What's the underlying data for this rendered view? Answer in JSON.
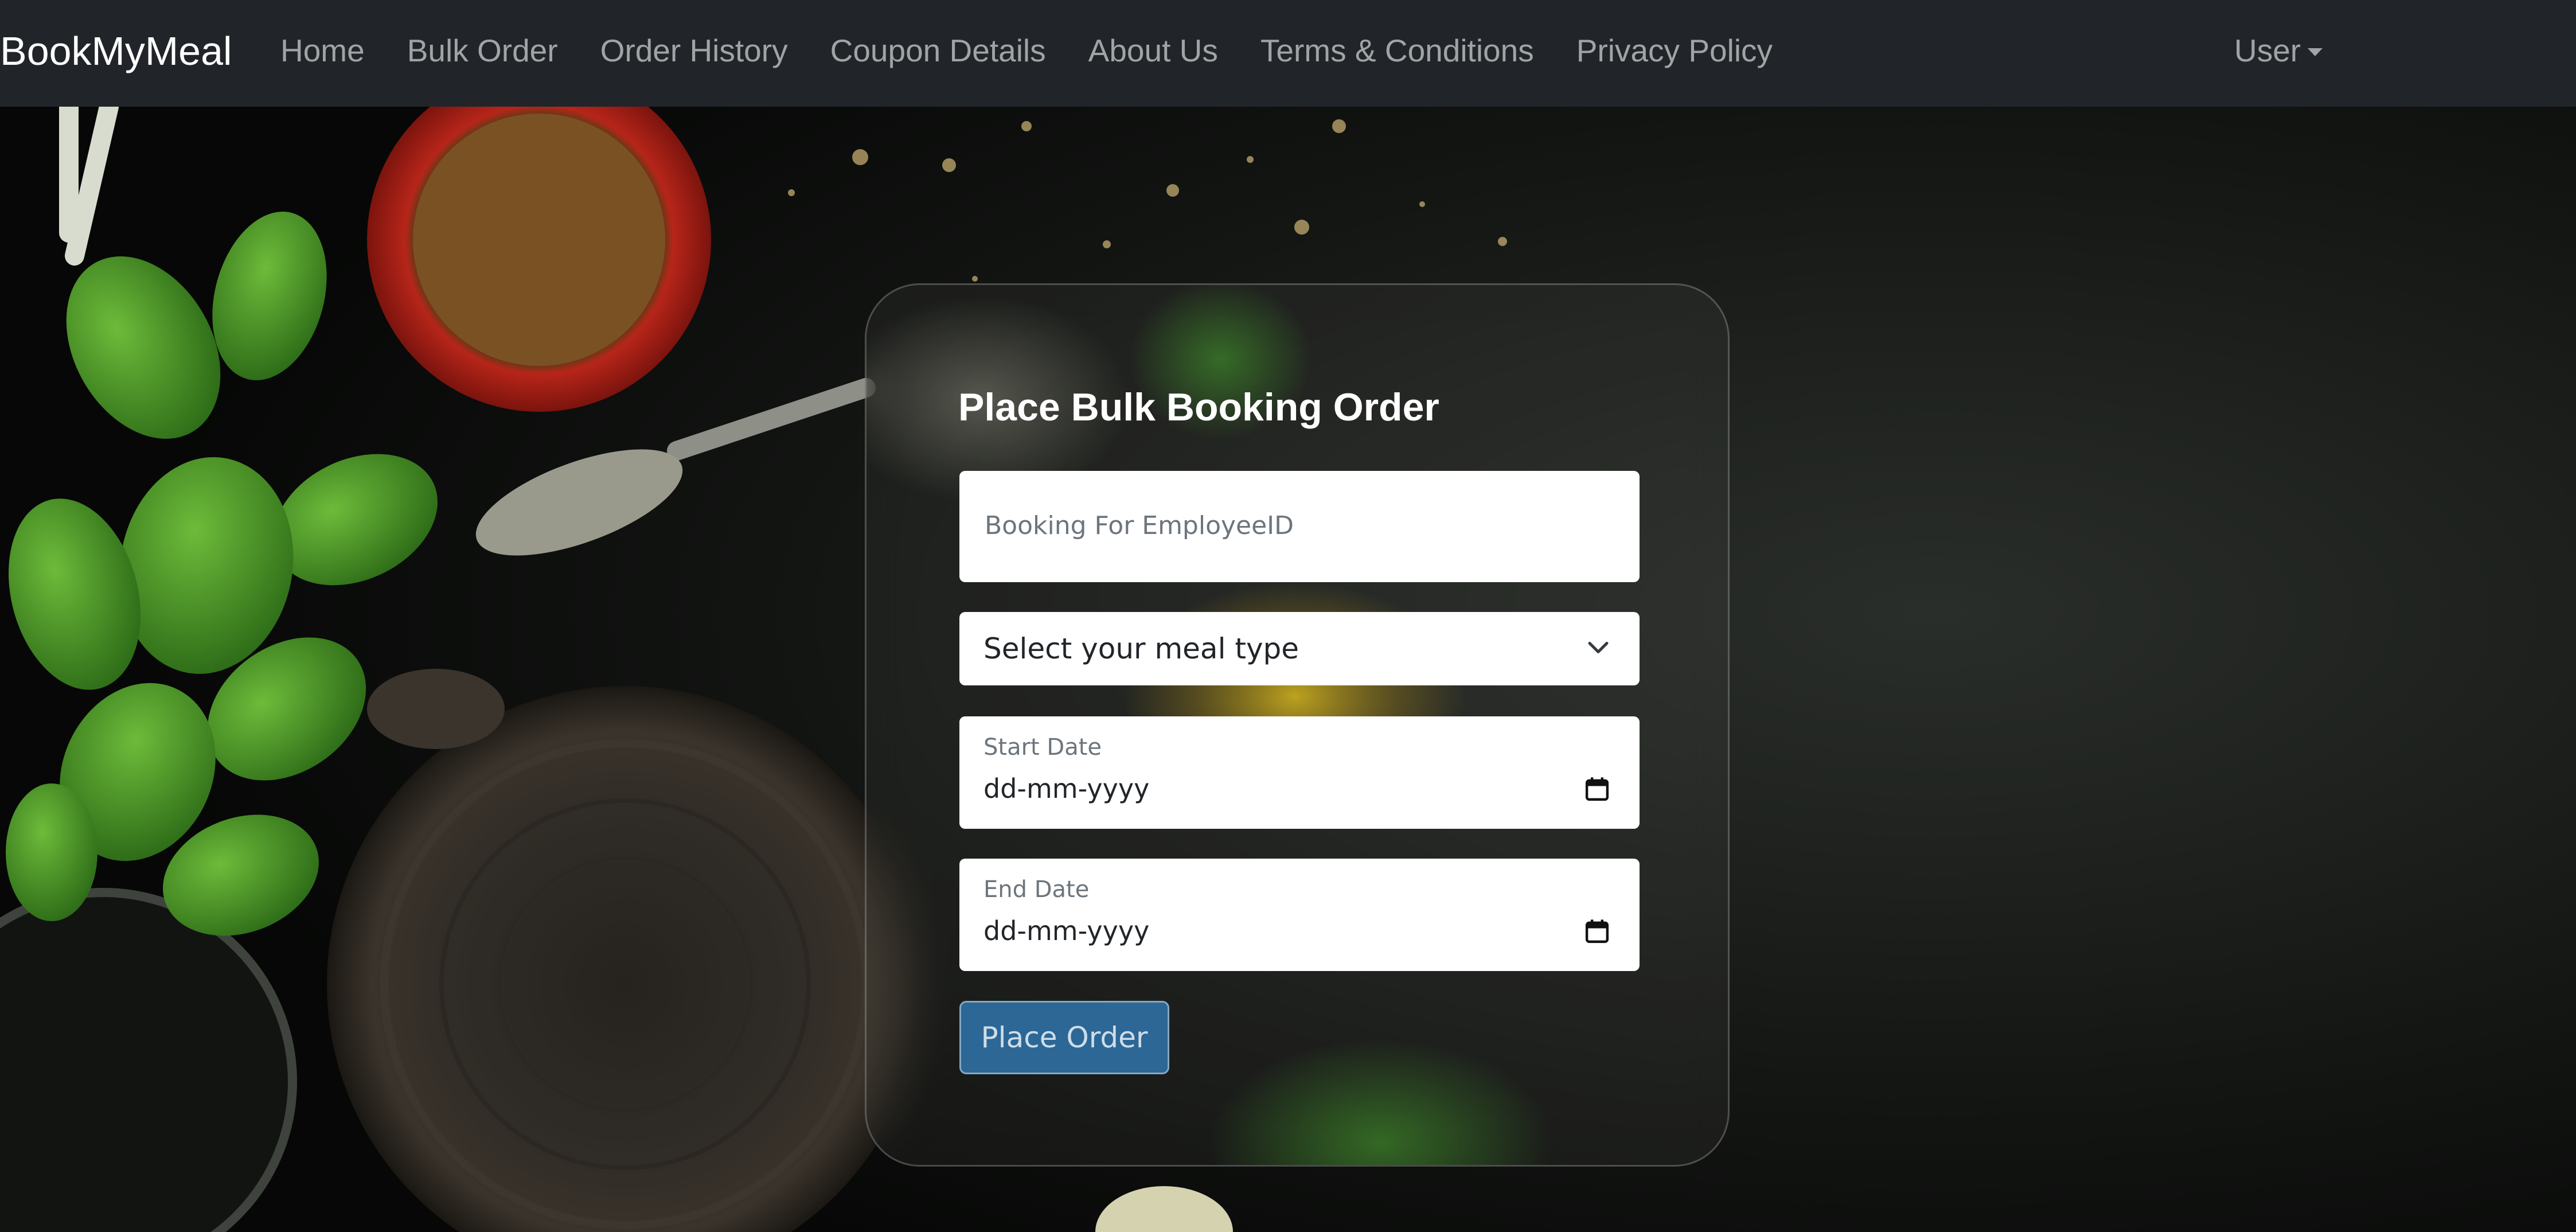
{
  "navbar": {
    "brand": "BookMyMeal",
    "links": [
      {
        "label": "Home"
      },
      {
        "label": "Bulk Order"
      },
      {
        "label": "Order History"
      },
      {
        "label": "Coupon Details"
      },
      {
        "label": "About Us"
      },
      {
        "label": "Terms & Conditions"
      },
      {
        "label": "Privacy Policy"
      }
    ],
    "user_menu": {
      "label": "User",
      "icon": "caret-down-icon"
    }
  },
  "form": {
    "title": "Place Bulk Booking Order",
    "employee_id": {
      "placeholder": "Booking For EmployeeID",
      "value": ""
    },
    "meal_type": {
      "selected": "Select your meal type",
      "icon": "chevron-down-icon"
    },
    "start_date": {
      "label": "Start Date",
      "value": "dd-mm-yyyy",
      "icon": "calendar-icon"
    },
    "end_date": {
      "label": "End Date",
      "value": "dd-mm-yyyy",
      "icon": "calendar-icon"
    },
    "submit_label": "Place Order"
  },
  "colors": {
    "navbar_bg": "#212529",
    "button_bg": "#2c6796",
    "page_bg": "#050605"
  }
}
